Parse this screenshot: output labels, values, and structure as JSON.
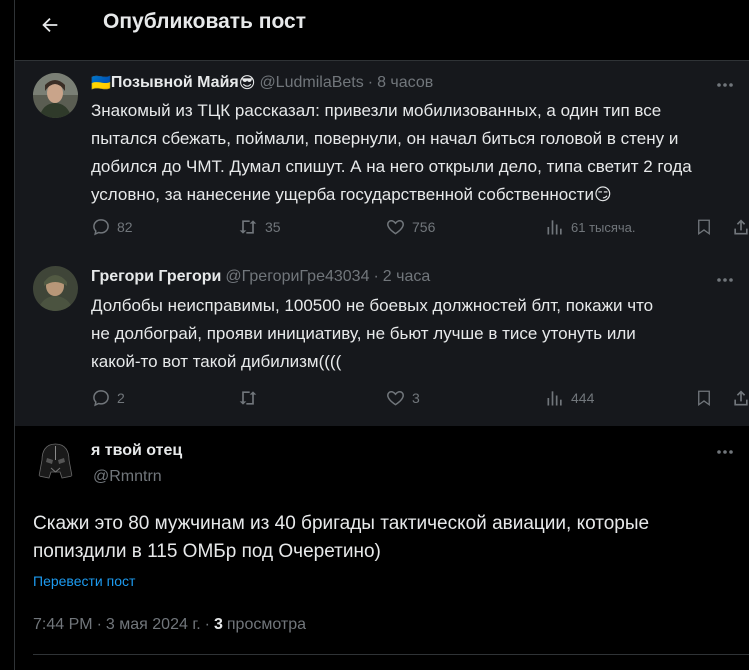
{
  "header": {
    "title": "Опубликовать пост"
  },
  "tweets": [
    {
      "name": "Позывной Майя",
      "name_emoji_before": "🇺🇦",
      "name_emoji_after": "😎",
      "handle": "@LudmilaBets",
      "time": "8 часов",
      "text": "Знакомый из ТЦК рассказал: привезли мобилизованных, а один тип все\nпытался сбежать, поймали, повернули, он начал биться головой в стену и\nдобился до ЧМТ. Думал спишут. А на него открыли дело, типа светит 2 года\nусловно, за нанесение ущерба государственной собственности😏",
      "actions": {
        "replies": "82",
        "reposts": "35",
        "likes": "756",
        "views": "61 тысяча."
      }
    },
    {
      "name": "Грегори Грегори",
      "handle": "@ГрегориГре43034",
      "time": "2 часа",
      "text": "Долбобы неисправимы, 100500 не боевых должностей блт, покажи что\nне долбограй, прояви инициативу, не бьют лучше в тисе утонуть или\nкакой-то вот такой дибилизм((((",
      "actions": {
        "replies": "2",
        "reposts": "",
        "likes": "3",
        "views": "444"
      }
    }
  ],
  "main_post": {
    "name": "я твой отец",
    "handle": "@Rmntrn",
    "text": "Скажи это 80 мужчинам из 40 бригады тактической авиации, которые\nпопиздили в 115 ОМБр под Очеретино)",
    "translate": "Перевести пост",
    "time": "7:44 PM",
    "date": "3 мая 2024 г.",
    "views_count": "3",
    "views_label": "просмотра"
  },
  "colors": {
    "background": "#000000",
    "reply_background": "#16181c",
    "muted": "#71767b",
    "link": "#1d9bf0"
  }
}
